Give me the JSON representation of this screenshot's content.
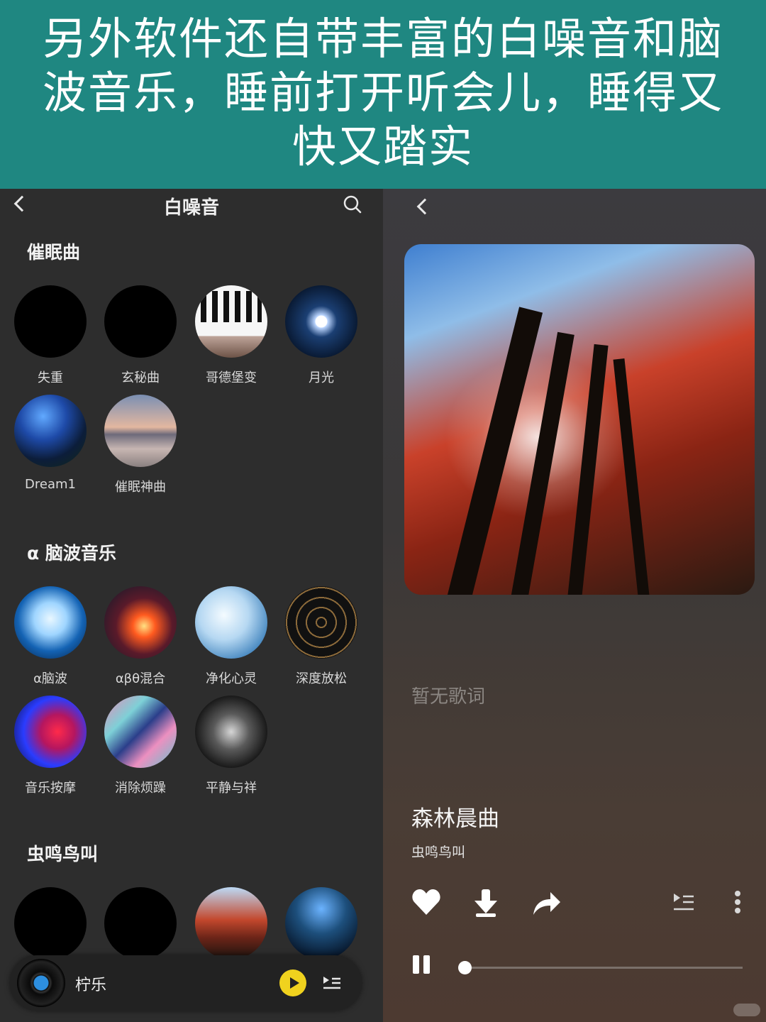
{
  "banner": {
    "line1": "另外软件还自带丰富的白噪音和脑",
    "line2": "波音乐，睡前打开听会儿，睡得又",
    "line3": "快又踏实"
  },
  "left": {
    "title": "白噪音",
    "sections": [
      {
        "title": "催眠曲",
        "items": [
          {
            "label": "失重",
            "art": "black"
          },
          {
            "label": "玄秘曲",
            "art": "black"
          },
          {
            "label": "哥德堡变",
            "art": "piano"
          },
          {
            "label": "月光",
            "art": "moon"
          },
          {
            "label": "Dream1",
            "art": "dream"
          },
          {
            "label": "催眠神曲",
            "art": "swan"
          }
        ]
      },
      {
        "title": "α 脑波音乐",
        "items": [
          {
            "label": "α脑波",
            "art": "brain"
          },
          {
            "label": "αβθ混合",
            "art": "nebula"
          },
          {
            "label": "净化心灵",
            "art": "water"
          },
          {
            "label": "深度放松",
            "art": "tunnel"
          },
          {
            "label": "音乐按摩",
            "art": "neon"
          },
          {
            "label": "消除烦躁",
            "art": "marble"
          },
          {
            "label": "平静与祥",
            "art": "smoke"
          }
        ]
      },
      {
        "title": "虫鸣鸟叫",
        "items": [
          {
            "label": "",
            "art": "black"
          },
          {
            "label": "",
            "art": "black"
          },
          {
            "label": "",
            "art": "forest"
          },
          {
            "label": "",
            "art": "stars"
          }
        ]
      }
    ],
    "mini_player": {
      "title": "柠乐"
    }
  },
  "right": {
    "lyrics_placeholder": "暂无歌词",
    "song_title": "森林晨曲",
    "song_artist": "虫鸣鸟叫",
    "progress": 0.0
  },
  "colors": {
    "banner": "#1f8781",
    "left_bg": "#2d2d2d",
    "play_button": "#f0d21e"
  }
}
